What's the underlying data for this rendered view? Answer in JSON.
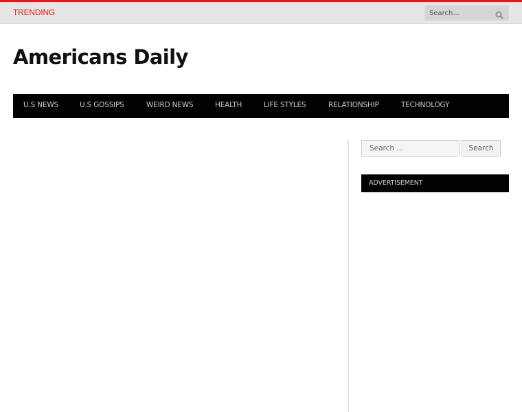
{
  "colors": {
    "accent": "#e01a1a",
    "nav_background": "#020203",
    "topbar_background": "#e6e6e6"
  },
  "topbar": {
    "trending_label": "TRENDING",
    "search_placeholder": "Search...",
    "search_icon": "magnifier-icon"
  },
  "header": {
    "site_title": "Americans Daily"
  },
  "nav": {
    "items": [
      {
        "label": "U.S NEWS"
      },
      {
        "label": "U.S GOSSIPS"
      },
      {
        "label": "WEIRD NEWS"
      },
      {
        "label": "HEALTH"
      },
      {
        "label": "LIFE STYLES"
      },
      {
        "label": "RELATIONSHIP"
      },
      {
        "label": "TECHNOLOGY"
      }
    ]
  },
  "sidebar": {
    "search_placeholder": "Search …",
    "search_button_label": "Search",
    "advertisement_heading": "ADVERTISEMENT"
  }
}
